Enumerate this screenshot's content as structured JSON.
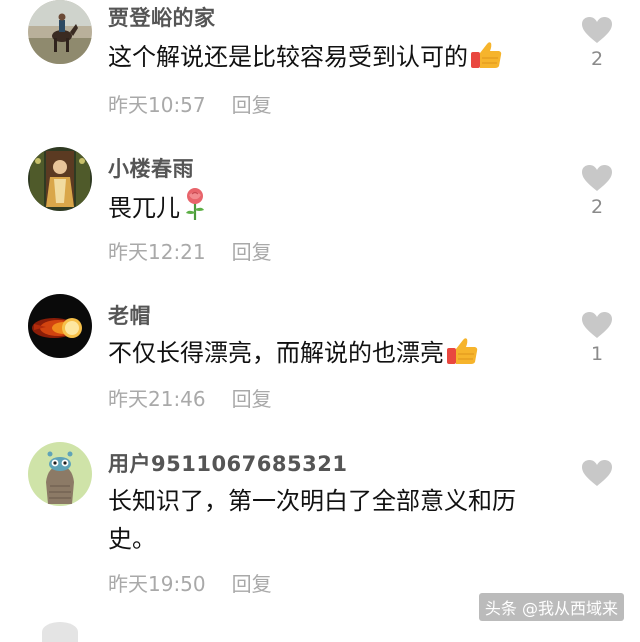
{
  "comments": [
    {
      "username": "贾登峪的家",
      "text": "这个解说还是比较容易受到认可的",
      "emoji": "thumbs-up-emoji",
      "time": "昨天10:57",
      "reply_label": "回复",
      "likes": "2",
      "avatar": "horse-rider-avatar"
    },
    {
      "username": "小楼春雨",
      "text": "畏兀儿",
      "emoji": "rose-emoji",
      "time": "昨天12:21",
      "reply_label": "回复",
      "likes": "2",
      "avatar": "portrait-avatar"
    },
    {
      "username": "老帽",
      "text": "不仅长得漂亮，而解说的也漂亮",
      "emoji": "thumbs-up-emoji",
      "time": "昨天21:46",
      "reply_label": "回复",
      "likes": "1",
      "avatar": "fireball-avatar"
    },
    {
      "username": "用户9511067685321",
      "text": "长知识了，第一次明白了全部意义和历史。",
      "emoji": "",
      "time": "昨天19:50",
      "reply_label": "回复",
      "likes": "",
      "avatar": "cartoon-creature-avatar"
    }
  ],
  "watermark": "头条 @我从西域来",
  "colors": {
    "username": "#555555",
    "text": "#111111",
    "meta": "#a9a9a9",
    "heart": "#c8c8c8"
  }
}
